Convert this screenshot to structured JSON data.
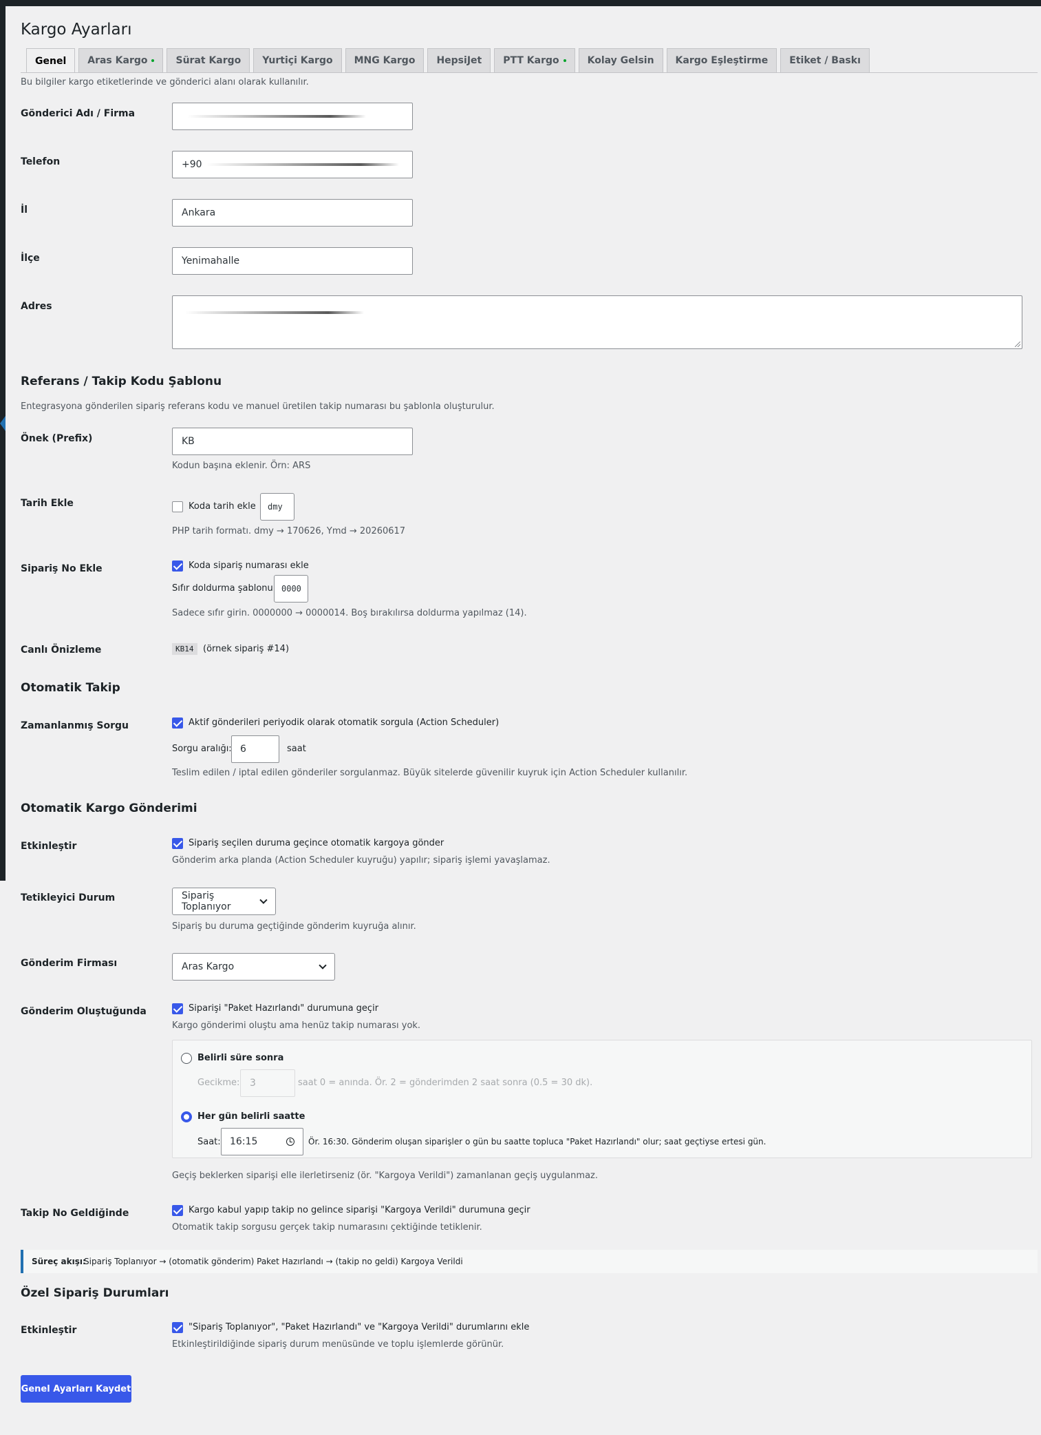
{
  "page_title": "Kargo Ayarları",
  "tabs": [
    {
      "label": "Genel",
      "active": true,
      "dot": false
    },
    {
      "label": "Aras Kargo",
      "active": false,
      "dot": true
    },
    {
      "label": "Sürat Kargo",
      "active": false,
      "dot": false
    },
    {
      "label": "Yurtiçi Kargo",
      "active": false,
      "dot": false
    },
    {
      "label": "MNG Kargo",
      "active": false,
      "dot": false
    },
    {
      "label": "HepsiJet",
      "active": false,
      "dot": false
    },
    {
      "label": "PTT Kargo",
      "active": false,
      "dot": true
    },
    {
      "label": "Kolay Gelsin",
      "active": false,
      "dot": false
    },
    {
      "label": "Kargo Eşleştirme",
      "active": false,
      "dot": false
    },
    {
      "label": "Etiket / Baskı",
      "active": false,
      "dot": false
    }
  ],
  "sender": {
    "intro": "Bu bilgiler kargo etiketlerinde ve gönderici alanı olarak kullanılır.",
    "name_label": "Gönderici Adı / Firma",
    "phone_label": "Telefon",
    "phone_prefix": "+90",
    "city_label": "İl",
    "city_value": "Ankara",
    "district_label": "İlçe",
    "district_value": "Yenimahalle",
    "address_label": "Adres"
  },
  "reference": {
    "title": "Referans / Takip Kodu Şablonu",
    "desc": "Entegrasyona gönderilen sipariş referans kodu ve manuel üretilen takip numarası bu şablonla oluşturulur.",
    "prefix_label": "Önek (Prefix)",
    "prefix_value": "KB",
    "prefix_help": "Kodun başına eklenir. Örn: ARS",
    "date_label": "Tarih Ekle",
    "date_checkbox": "Koda tarih ekle",
    "date_format": "dmy",
    "date_help": "PHP tarih formatı. dmy → 170626, Ymd → 20260617",
    "order_label": "Sipariş No Ekle",
    "order_checkbox": "Koda sipariş numarası ekle",
    "pad_label": "Sıfır doldurma şablonu:",
    "pad_value": "0000",
    "pad_help": "Sadece sıfır girin. 0000000 → 0000014. Boş bırakılırsa doldurma yapılmaz (14).",
    "preview_label": "Canlı Önizleme",
    "preview_code": "KB14",
    "preview_note": "(örnek sipariş #14)"
  },
  "auto_tracking": {
    "title": "Otomatik Takip",
    "label": "Zamanlanmış Sorgu",
    "checkbox": "Aktif gönderileri periyodik olarak otomatik sorgula (Action Scheduler)",
    "interval_label": "Sorgu aralığı:",
    "interval_value": "6",
    "interval_unit": "saat",
    "help": "Teslim edilen / iptal edilen gönderiler sorgulanmaz. Büyük sitelerde güvenilir kuyruk için Action Scheduler kullanılır."
  },
  "auto_shipping": {
    "title": "Otomatik Kargo Gönderimi",
    "enable_label": "Etkinleştir",
    "enable_checkbox": "Sipariş seçilen duruma geçince otomatik kargoya gönder",
    "enable_help": "Gönderim arka planda (Action Scheduler kuyruğu) yapılır; sipariş işlemi yavaşlamaz.",
    "trigger_label": "Tetikleyici Durum",
    "trigger_value": "Sipariş Toplanıyor",
    "trigger_help": "Sipariş bu duruma geçtiğinde gönderim kuyruğa alınır.",
    "carrier_label": "Gönderim Firması",
    "carrier_value": "Aras Kargo",
    "created_label": "Gönderim Oluştuğunda",
    "created_checkbox": "Siparişi \"Paket Hazırlandı\" durumuna geçir",
    "created_help": "Kargo gönderimi oluştu ama henüz takip numarası yok.",
    "radio_delay": "Belirli süre sonra",
    "delay_label": "Gecikme:",
    "delay_value": "3",
    "delay_help": "saat 0 = anında. Ör. 2 = gönderimden 2 saat sonra (0.5 = 30 dk).",
    "radio_daily": "Her gün belirli saatte",
    "time_label": "Saat:",
    "time_value": "16:15",
    "time_help": "Ör. 16:30. Gönderim oluşan siparişler o gün bu saatte topluca \"Paket Hazırlandı\" olur; saat geçtiyse ertesi gün.",
    "manual_help": "Geçiş beklerken siparişi elle ilerletirseniz (ör. \"Kargoya Verildi\") zamanlanan geçiş uygulanmaz.",
    "tracking_label": "Takip No Geldiğinde",
    "tracking_checkbox": "Kargo kabul yapıp takip no gelince siparişi \"Kargoya Verildi\" durumuna geçir",
    "tracking_help": "Otomatik takip sorgusu gerçek takip numarasını çektiğinde tetiklenir."
  },
  "flow": {
    "label": "Süreç akışı:",
    "text": "Sipariş Toplanıyor → (otomatik gönderim) Paket Hazırlandı → (takip no geldi) Kargoya Verildi"
  },
  "custom_status": {
    "title": "Özel Sipariş Durumları",
    "label": "Etkinleştir",
    "checkbox": "\"Sipariş Toplanıyor\", \"Paket Hazırlandı\" ve \"Kargoya Verildi\" durumlarını ekle",
    "help": "Etkinleştirildiğinde sipariş durum menüsünde ve toplu işlemlerde görünür."
  },
  "save_button": "Genel Ayarları Kaydet",
  "colors": {
    "accent": "#3858e9",
    "notice_border": "#2271b1",
    "dot": "#00a32a"
  }
}
